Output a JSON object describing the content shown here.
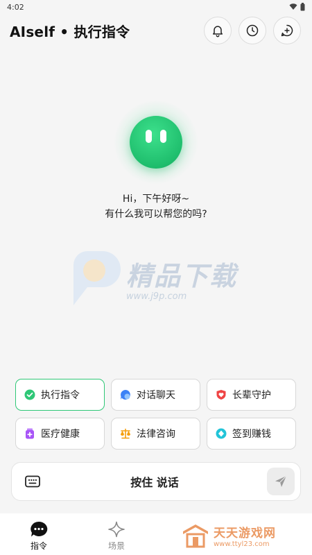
{
  "status": {
    "time": "4:02"
  },
  "header": {
    "title": "AIself • 执行指令"
  },
  "greeting": {
    "line1": "Hi，下午好呀~",
    "line2": "有什么我可以帮您的吗?"
  },
  "watermark": {
    "text": "精品下载",
    "url": "www.j9p.com"
  },
  "quick_actions": [
    {
      "label": "执行指令",
      "icon": "check-circle-icon",
      "color": "#2ec776",
      "active": true
    },
    {
      "label": "对话聊天",
      "icon": "chat-bubble-icon",
      "color": "#3b82f6",
      "active": false
    },
    {
      "label": "长辈守护",
      "icon": "heart-shield-icon",
      "color": "#ef4444",
      "active": false
    },
    {
      "label": "医疗健康",
      "icon": "medicine-icon",
      "color": "#a855f7",
      "active": false
    },
    {
      "label": "法律咨询",
      "icon": "scales-icon",
      "color": "#f59e0b",
      "active": false
    },
    {
      "label": "签到赚钱",
      "icon": "diamond-icon",
      "color": "#06b6d4",
      "active": false
    }
  ],
  "input": {
    "hold_label": "按住 说话"
  },
  "nav": [
    {
      "label": "指令",
      "icon": "chat-dots-icon",
      "active": true
    },
    {
      "label": "场景",
      "icon": "sparkle-icon",
      "active": false
    }
  ],
  "corner_watermark": {
    "title": "天天游戏网",
    "url": "www.ttyl23.com"
  },
  "colors": {
    "accent": "#2ec776",
    "background": "#f5f5f5"
  }
}
